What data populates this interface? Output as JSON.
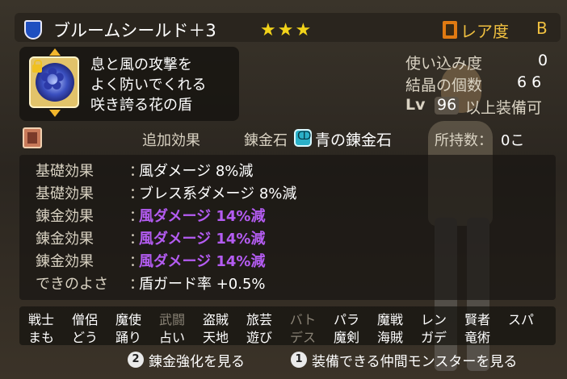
{
  "item": {
    "name": "ブルームシールド＋3",
    "stars": "★★★",
    "rarity_label": "レア度",
    "rarity_value": "B",
    "description": [
      "息と風の攻撃を",
      "よく防いでくれる",
      "咲き誇る花の盾"
    ]
  },
  "stats": {
    "usage_label": "使い込み度",
    "usage_value": "0",
    "crystal_label": "結晶の個数",
    "crystal_value": "6 6",
    "lv_prefix": "Lv",
    "lv_value": "96",
    "lv_suffix": "以上装備可"
  },
  "tabs": {
    "extra_effect": "追加効果",
    "alchemy_stone_label": "錬金石",
    "alchemy_stone_name": "青の錬金石",
    "owned_label": "所持数：",
    "owned_value": "0こ"
  },
  "effects": [
    {
      "label": "基礎効果",
      "colon": "：",
      "value": "風ダメージ 8%減",
      "highlight": false
    },
    {
      "label": "基礎効果",
      "colon": "：",
      "value": "ブレス系ダメージ 8%減",
      "highlight": false
    },
    {
      "label": "錬金効果",
      "colon": "：",
      "value": "風ダメージ 14%減",
      "highlight": true
    },
    {
      "label": "錬金効果",
      "colon": "：",
      "value": "風ダメージ 14%減",
      "highlight": true
    },
    {
      "label": "錬金効果",
      "colon": "：",
      "value": "風ダメージ 14%減",
      "highlight": true
    },
    {
      "label": "できのよさ",
      "colon": "：",
      "value": "盾ガード率 +0.5%",
      "highlight": false
    }
  ],
  "jobs_row1": [
    {
      "name": "戦士",
      "available": true
    },
    {
      "name": "僧侶",
      "available": true
    },
    {
      "name": "魔使",
      "available": true
    },
    {
      "name": "武闘",
      "available": false
    },
    {
      "name": "盗賊",
      "available": true
    },
    {
      "name": "旅芸",
      "available": true
    },
    {
      "name": "バト",
      "available": false
    },
    {
      "name": "パラ",
      "available": true
    },
    {
      "name": "魔戦",
      "available": true
    },
    {
      "name": "レン",
      "available": true
    },
    {
      "name": "賢者",
      "available": true
    },
    {
      "name": "スパ",
      "available": true
    }
  ],
  "jobs_row2": [
    {
      "name": "まも",
      "available": true
    },
    {
      "name": "どう",
      "available": true
    },
    {
      "name": "踊り",
      "available": true
    },
    {
      "name": "占い",
      "available": true
    },
    {
      "name": "天地",
      "available": true
    },
    {
      "name": "遊び",
      "available": true
    },
    {
      "name": "デス",
      "available": false
    },
    {
      "name": "魔剣",
      "available": true
    },
    {
      "name": "海賊",
      "available": true
    },
    {
      "name": "ガデ",
      "available": true
    },
    {
      "name": "竜術",
      "available": true
    }
  ],
  "footer": {
    "btn2_num": "2",
    "btn2_label": "錬金強化を見る",
    "btn1_num": "1",
    "btn1_label": "装備できる仲間モンスターを見る"
  },
  "colors": {
    "highlight_purple": "#b45cf2",
    "stars_yellow": "#f2d31a",
    "rarity_gold": "#f0c040",
    "shield_blue": "#1f4fc0"
  },
  "icons": [
    "shield-icon",
    "lock-icon",
    "flower-shield-icon",
    "book-icon",
    "alchemy-stone-icon",
    "rarity-icon"
  ]
}
